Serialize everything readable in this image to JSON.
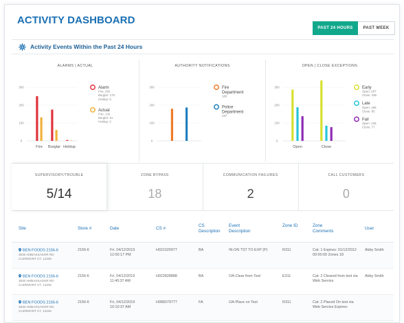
{
  "header": {
    "title": "ACTIVITY DASHBOARD",
    "range_options": [
      {
        "label": "PAST 24 HOURS",
        "active": true
      },
      {
        "label": "PAST WEEK",
        "active": false
      }
    ]
  },
  "section": {
    "title": "Activity Events Within the Past 24 Hours",
    "icon": "gear-icon"
  },
  "chart_data": [
    {
      "type": "bar",
      "title": "ALARMS | ACTUAL",
      "categories": [
        "Fire",
        "Burglar",
        "Holdup"
      ],
      "ylim": [
        0,
        300
      ],
      "yticks": [
        "300",
        "200",
        "100",
        "0"
      ],
      "series": [
        {
          "name": "Alarm",
          "color": "#e0323c",
          "values": [
            250,
            175,
            5
          ]
        },
        {
          "name": "Actual",
          "color": "#f0b23a",
          "values": [
            132,
            61,
            2
          ]
        }
      ],
      "legend": [
        {
          "name": "Alarm",
          "color": "#e0323c",
          "lines": [
            "Fire: 250",
            "Burglar: 175",
            "Holdup: 5"
          ]
        },
        {
          "name": "Actual",
          "color": "#f0b23a",
          "lines": [
            "Fire: 132",
            "Burglar: 61",
            "Holdup: 2"
          ]
        }
      ]
    },
    {
      "type": "bar",
      "title": "AUTHORITY NOTIFICATIONS",
      "categories": [
        ""
      ],
      "ylim": [
        0,
        300
      ],
      "yticks": [
        "300",
        "200",
        "100",
        "0"
      ],
      "series": [
        {
          "name": "Fire Department",
          "color": "#f07a26",
          "values": [
            180
          ]
        },
        {
          "name": "Police Department",
          "color": "#1f7fbf",
          "values": [
            187
          ]
        }
      ],
      "legend": [
        {
          "name": "Fire Department",
          "color": "#f07a26",
          "lines": [
            "180"
          ]
        },
        {
          "name": "Police Department",
          "color": "#1f7fbf",
          "lines": [
            "187"
          ]
        }
      ]
    },
    {
      "type": "bar",
      "title": "OPEN | CLOSE EXCEPTIONS",
      "categories": [
        "Open",
        "Close"
      ],
      "ylim": [
        0,
        300
      ],
      "yticks": [
        "300",
        "200",
        "100",
        "0"
      ],
      "series": [
        {
          "name": "Early",
          "color": "#d8e02e",
          "values": [
            287,
            338
          ]
        },
        {
          "name": "Late",
          "color": "#27c4d9",
          "values": [
            188,
            85
          ]
        },
        {
          "name": "Fail",
          "color": "#8e2bb3",
          "values": [
            138,
            77
          ]
        }
      ],
      "legend": [
        {
          "name": "Early",
          "color": "#d8e02e",
          "lines": [
            "Open: 287",
            "Close: 338"
          ]
        },
        {
          "name": "Late",
          "color": "#27c4d9",
          "lines": [
            "Open: 188",
            "Close: 85"
          ]
        },
        {
          "name": "Fail",
          "color": "#8e2bb3",
          "lines": [
            "Open: 138",
            "Close: 77"
          ]
        }
      ]
    }
  ],
  "kpis": [
    {
      "label": "SUPERVISORY/TROUBLE",
      "value": "5/14",
      "style": "strong"
    },
    {
      "label": "ZONE BYPASS",
      "value": "18",
      "style": "muted"
    },
    {
      "label": "COMMUNICATION FAILURES",
      "value": "2",
      "style": "normal"
    },
    {
      "label": "CALL CUSTOMERS",
      "value": "0",
      "style": "muted"
    }
  ],
  "table": {
    "columns": [
      "Site",
      "Store #",
      "Date",
      "CS #",
      "CS Description",
      "Event Description",
      "Zone ID",
      "Zone Comments",
      "User"
    ],
    "rows": [
      {
        "site_name": "BEN FOODS 2156-6",
        "site_addr1": "3830 AMBASSADOR RD",
        "site_addr2": "CLERMONT CT, 12345",
        "store": "2156-6",
        "date1": "Fri, 04/12/2019",
        "date2": "12:00:17 PM",
        "cs": "H021020977",
        "cs_desc": "BA",
        "event": "IN-ON TST TO EXP (P)",
        "zone": "R311",
        "comments": "Cat: 1 Expires: 01/12/2012 00:00:00 Zones 18",
        "user": "Abby Smith"
      },
      {
        "site_name": "BEN FOODS 2156-6",
        "site_addr1": "3830 AMBASSADOR RD",
        "site_addr2": "CLERMONT CT, 12345",
        "store": "2156-6",
        "date1": "Fri, 04/12/2019",
        "date2": "11:40:37 AM",
        "cs": "H022828888",
        "cs_desc": "BA",
        "event": "OA-Clear from Test",
        "zone": "E311",
        "comments": "Cat: 2 Cleared from test via Web Service",
        "user": "Abby Smith"
      },
      {
        "site_name": "BEN FOODS 2156-6",
        "site_addr1": "3830 AMBASSADOR RD",
        "site_addr2": "CLERMONT CT, 12345",
        "store": "2156-6",
        "date1": "Fri, 04/12/2019",
        "date2": "10:10:37 AM",
        "cs": "H088379777",
        "cs_desc": "FA",
        "event": "OA-Place on Test",
        "zone": "R311",
        "comments": "Cat: 2 Placed On test via Web Service Expires:",
        "user": ""
      }
    ]
  }
}
